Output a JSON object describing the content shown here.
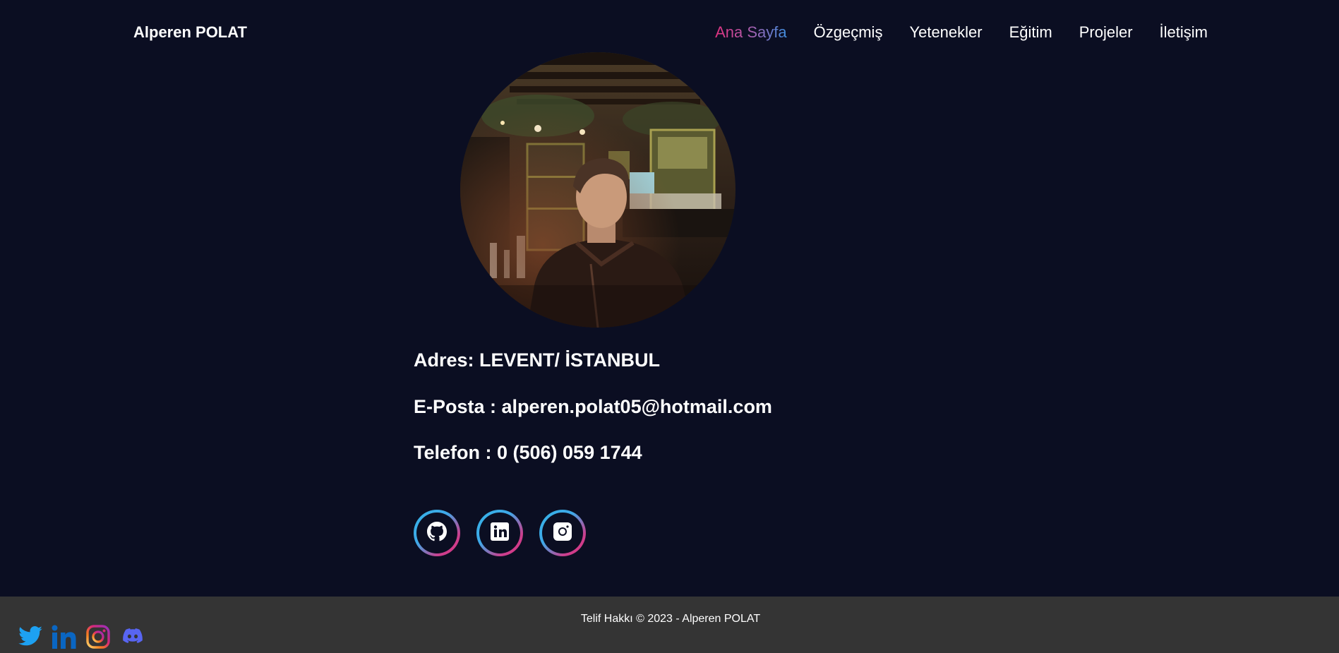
{
  "header": {
    "brand": "Alperen POLAT",
    "nav": [
      {
        "label": "Ana Sayfa",
        "active": true
      },
      {
        "label": "Özgeçmiş"
      },
      {
        "label": "Yetenekler"
      },
      {
        "label": "Eğitim"
      },
      {
        "label": "Projeler"
      },
      {
        "label": "İletişim"
      }
    ]
  },
  "contact": {
    "address": "Adres: LEVENT/ İSTANBUL",
    "email": "E-Posta : alperen.polat05@hotmail.com",
    "phone": "Telefon : 0 (506) 059 1744"
  },
  "social_buttons": [
    {
      "icon": "github-icon"
    },
    {
      "icon": "linkedin-icon"
    },
    {
      "icon": "instagram-icon"
    }
  ],
  "footer": {
    "copyright": "Telif Hakkı © 2023 - Alperen POLAT",
    "icons": [
      "twitter-icon",
      "linkedin-icon",
      "instagram-icon",
      "discord-icon"
    ]
  },
  "colors": {
    "background": "#0b0e22",
    "footer_background": "#343434",
    "accent_pink": "#e0317f",
    "accent_blue": "#34b3e6",
    "twitter_blue": "#1da1f2",
    "linkedin_blue": "#0a66c2",
    "discord_purple": "#5865f2"
  }
}
